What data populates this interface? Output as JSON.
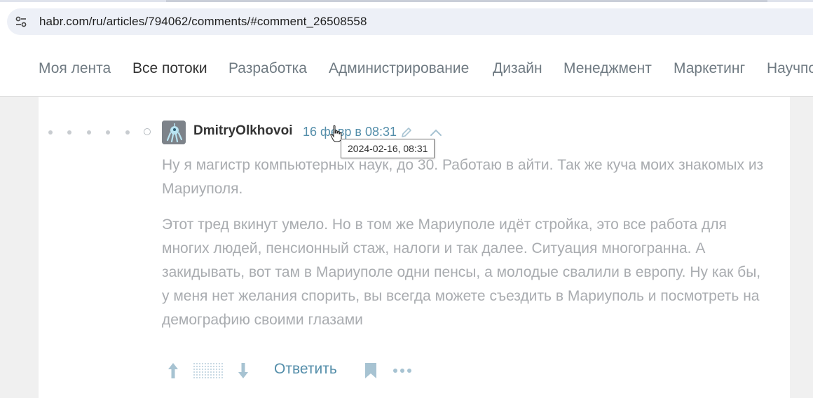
{
  "browser": {
    "url": "habr.com/ru/articles/794062/comments/#comment_26508558",
    "site_info_icon": "tune-icon"
  },
  "nav": {
    "items": [
      {
        "label": "Моя лента",
        "active": false
      },
      {
        "label": "Все потоки",
        "active": true
      },
      {
        "label": "Разработка",
        "active": false
      },
      {
        "label": "Администрирование",
        "active": false
      },
      {
        "label": "Дизайн",
        "active": false
      },
      {
        "label": "Менеджмент",
        "active": false
      },
      {
        "label": "Маркетинг",
        "active": false
      },
      {
        "label": "Научпоп",
        "active": false
      }
    ]
  },
  "comment": {
    "author": "DmitryOlkhovoi",
    "timestamp": "16 февр в 08:31",
    "tooltip": "2024-02-16, 08:31",
    "paragraphs": [
      "Ну я магистр компьютерных наук, до 30. Работаю в айти. Так же куча моих знакомых из Мариуполя.",
      "Этот тред вкинут умело. Но в том же Мариуполе идёт стройка, это все работа для многих людей, пенсионный стаж, налоги и так далее. Ситуация многогранна. А закидывать, вот там в Мариуполе одни пенсы, а молодые свалили в европу. Ну как бы, у меня нет желания спорить, вы всегда можете съездить в Мариуполь и посмотреть на демографию своими глазами"
    ],
    "actions": {
      "reply_label": "Ответить"
    },
    "icons": [
      "thread-dot-icon",
      "avatar",
      "edit-icon",
      "collapse-icon",
      "vote-up-icon",
      "vote-down-icon",
      "bookmark-icon",
      "more-icon"
    ]
  },
  "colors": {
    "link": "#548eaa",
    "muted_text": "#a9acb0",
    "nav_text": "#6f7a82",
    "nav_active": "#333333"
  }
}
